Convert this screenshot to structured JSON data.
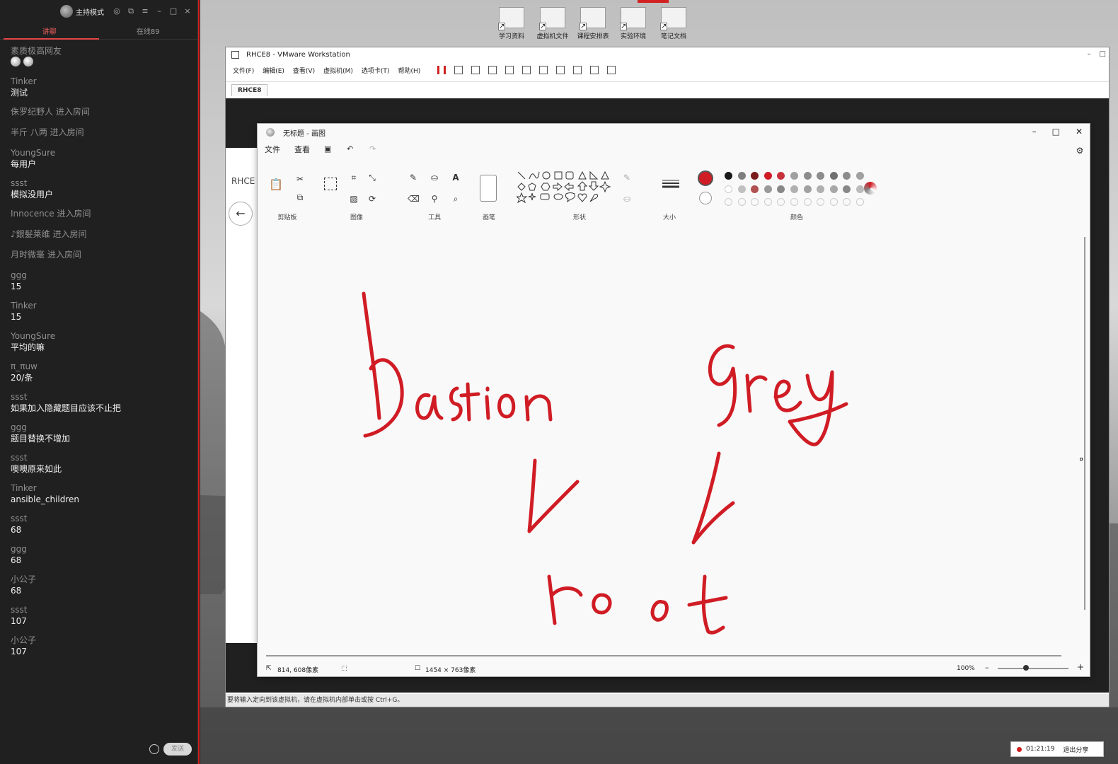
{
  "chat": {
    "host_mode": "主持模式",
    "tabs": [
      "讲聊",
      "在线89"
    ],
    "messages": [
      {
        "user": "素质极高网友",
        "text": "",
        "emojis": 2
      },
      {
        "user": "Tinker",
        "text": "测试"
      },
      {
        "user": "侏罗纪野人 进入房间",
        "text": ""
      },
      {
        "user": "半斤 八两 进入房间",
        "text": ""
      },
      {
        "user": "YoungSure",
        "text": "每用户"
      },
      {
        "user": "ssst",
        "text": "模拟没用户"
      },
      {
        "user": "Innocence 进入房间",
        "text": ""
      },
      {
        "user": "♪銀髪莱维 进入房间",
        "text": ""
      },
      {
        "user": "月时微毫 进入房间",
        "text": ""
      },
      {
        "user": "ggg",
        "text": "15"
      },
      {
        "user": "Tinker",
        "text": "15"
      },
      {
        "user": "YoungSure",
        "text": "平均的嘛"
      },
      {
        "user": "π_πuw",
        "text": "20/条"
      },
      {
        "user": "ssst",
        "text": "如果加入隐藏题目应该不止把"
      },
      {
        "user": "ggg",
        "text": "题目替换不增加"
      },
      {
        "user": "ssst",
        "text": "噢噢原来如此"
      },
      {
        "user": "Tinker",
        "text": "ansible_children"
      },
      {
        "user": "ssst",
        "text": "68"
      },
      {
        "user": "ggg",
        "text": "68"
      },
      {
        "user": "小公子",
        "text": "68"
      },
      {
        "user": "ssst",
        "text": "107"
      },
      {
        "user": "小公子",
        "text": "107"
      }
    ],
    "send_label": "发送"
  },
  "desktop": {
    "icons": [
      "学习资料",
      "虚拟机文件",
      "课程安排表",
      "实验环境",
      "笔记文档"
    ]
  },
  "vmware": {
    "title": "RHCE8 - VMware Workstation",
    "menus": [
      "文件(F)",
      "编辑(E)",
      "查看(V)",
      "虚拟机(M)",
      "选项卡(T)",
      "帮助(H)"
    ],
    "tab": "RHCE8",
    "guest_label": "RHCE",
    "status_text": "要将输入定向到该虚拟机，请在虚拟机内部单击或按 Ctrl+G。"
  },
  "paint": {
    "title": "无标题 - 画图",
    "menus": [
      "文件",
      "查看"
    ],
    "groups": [
      "剪贴板",
      "图像",
      "工具",
      "画笔",
      "形状",
      "大小",
      "颜色"
    ],
    "status": {
      "cursor": "814, 608像素",
      "size": "1454 × 763像素",
      "zoom": "100%"
    },
    "strokes_color": "#d01c24",
    "handwriting": [
      "Bastion",
      "Grey",
      "root"
    ],
    "palette_row1": [
      "#1a1a1a",
      "#7f7f7f",
      "#7a1c1c",
      "#d01c24",
      "#c8323c",
      "#a0a0a0",
      "#8c8c8c",
      "#8c8c8c",
      "#707070",
      "#8c8c8c",
      "#a0a0a0"
    ],
    "palette_row2": [
      "#ffffff",
      "#c0c0c0",
      "#b05050",
      "#999999",
      "#888888",
      "#b0b0b0",
      "#a0a0a0",
      "#b0b0b0",
      "#a8a8a8",
      "#888888",
      "#bbbbbb"
    ]
  },
  "recording": {
    "time": "01:21:19",
    "exit_label": "退出分享"
  }
}
